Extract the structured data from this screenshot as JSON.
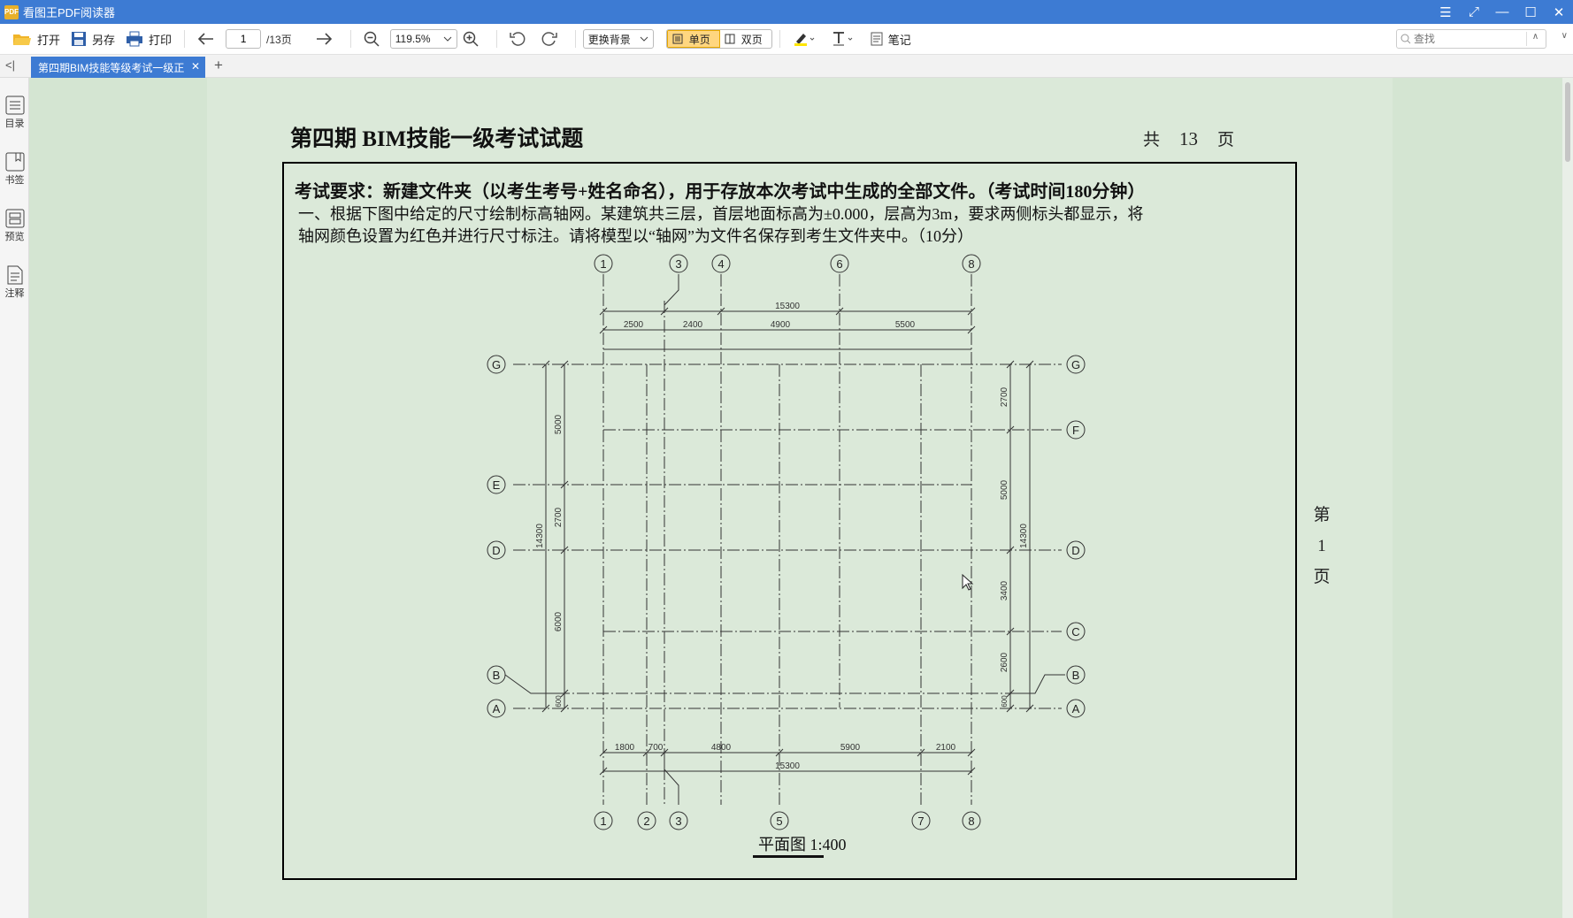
{
  "app": {
    "title": "看图王PDF阅读器",
    "icon_text": "PDF"
  },
  "window": {
    "menu_icon": "☰",
    "restore_icon": "⤢",
    "minimize_icon": "—",
    "maximize_icon": "☐",
    "close_icon": "✕"
  },
  "toolbar": {
    "open_label": "打开",
    "saveas_label": "另存",
    "print_label": "打印",
    "page_current": "1",
    "page_total": "/13页",
    "zoom_value": "119.5%",
    "background_label": "更换背景",
    "single_page_label": "单页",
    "double_page_label": "双页",
    "note_label": "笔记",
    "search_placeholder": "查找"
  },
  "tabs": {
    "active_label": "第四期BIM技能等级考试一级正",
    "close": "✕",
    "new_tab": "+",
    "collapse": "<|"
  },
  "sidebar": {
    "items": [
      {
        "label": "目录"
      },
      {
        "label": "书签"
      },
      {
        "label": "预览"
      },
      {
        "label": "注释"
      }
    ]
  },
  "page": {
    "title": "第四期 BIM技能一级考试试题",
    "total_prefix": "共",
    "total_number": "13",
    "total_suffix": "页",
    "requirement": "考试要求：新建文件夹（以考生考号+姓名命名），用于存放本次考试中生成的全部文件。（考试时间180分钟）",
    "question_line1": "一、根据下图中给定的尺寸绘制标高轴网。某建筑共三层，首层地面标高为±0.000，层高为3m，要求两侧标头都显示，将",
    "question_line2": "轴网颜色设置为红色并进行尺寸标注。请将模型以“轴网”为文件名保存到考生文件夹中。（10分）",
    "page_number": {
      "prefix": "第",
      "number": "1",
      "suffix": "页"
    },
    "caption": "平面图   1:400"
  },
  "drawing": {
    "top_axes": [
      "1",
      "3",
      "4",
      "6",
      "8"
    ],
    "bottom_axes": [
      "1",
      "2",
      "3",
      "5",
      "7",
      "8"
    ],
    "left_axes": [
      "G",
      "E",
      "D",
      "B",
      "A"
    ],
    "right_axes": [
      "G",
      "F",
      "D",
      "C",
      "B",
      "A"
    ],
    "top_total": "15300",
    "top_dims": [
      "2500",
      "2400",
      "4900",
      "5500"
    ],
    "bottom_total": "15300",
    "bottom_dims": [
      "1800",
      "700",
      "4800",
      "5900",
      "2100"
    ],
    "left_total": "14300",
    "left_dims": [
      "5000",
      "2700",
      "6000",
      "600"
    ],
    "right_total": "14300",
    "right_dims": [
      "2700",
      "5000",
      "3400",
      "2600",
      "600"
    ]
  }
}
